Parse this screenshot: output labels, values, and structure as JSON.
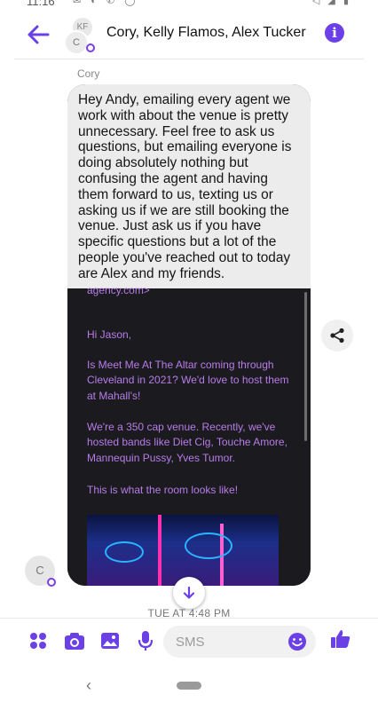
{
  "status_bar": {
    "time": "11:16",
    "left_icons": "✉ ◐ ✆ ◯",
    "right_icons": "◁ ◢ ▮"
  },
  "header": {
    "title": "Cory, Kelly Flamos, Alex Tucker",
    "avatar_front": "C",
    "avatar_back": "KF"
  },
  "message": {
    "sender": "Cory",
    "text": "Hey Andy, emailing every agent we work with about the venue is pretty unnecessary. Feel free to ask us questions, but emailing everyone is doing absolutely nothing but confusing the agent and having them forward to us, texting us or asking us if we are still booking the venue. Just ask us if you have specific questions but a lot of the people you've reached out to today are Alex and my friends.",
    "sender_avatar": "C"
  },
  "email_screenshot": {
    "top_fragment": "agency.com>",
    "greeting": "Hi Jason,",
    "para1": "Is Meet Me At The Altar coming through Cleveland in 2021? We'd love to host them at Mahall's!",
    "para2": "We're a 350 cap venue. Recently, we've hosted bands like Diet Cig, Touche Amore, Mannequin Pussy, Yves Tumor.",
    "para3": "This is what the room looks like!"
  },
  "timestamp": "TUE AT 4:48 PM",
  "composer": {
    "placeholder": "SMS"
  },
  "colors": {
    "accent": "#6b40e6",
    "bubble": "#ececec",
    "email_text": "#b67ce8",
    "email_bg": "#1b1b1f"
  }
}
